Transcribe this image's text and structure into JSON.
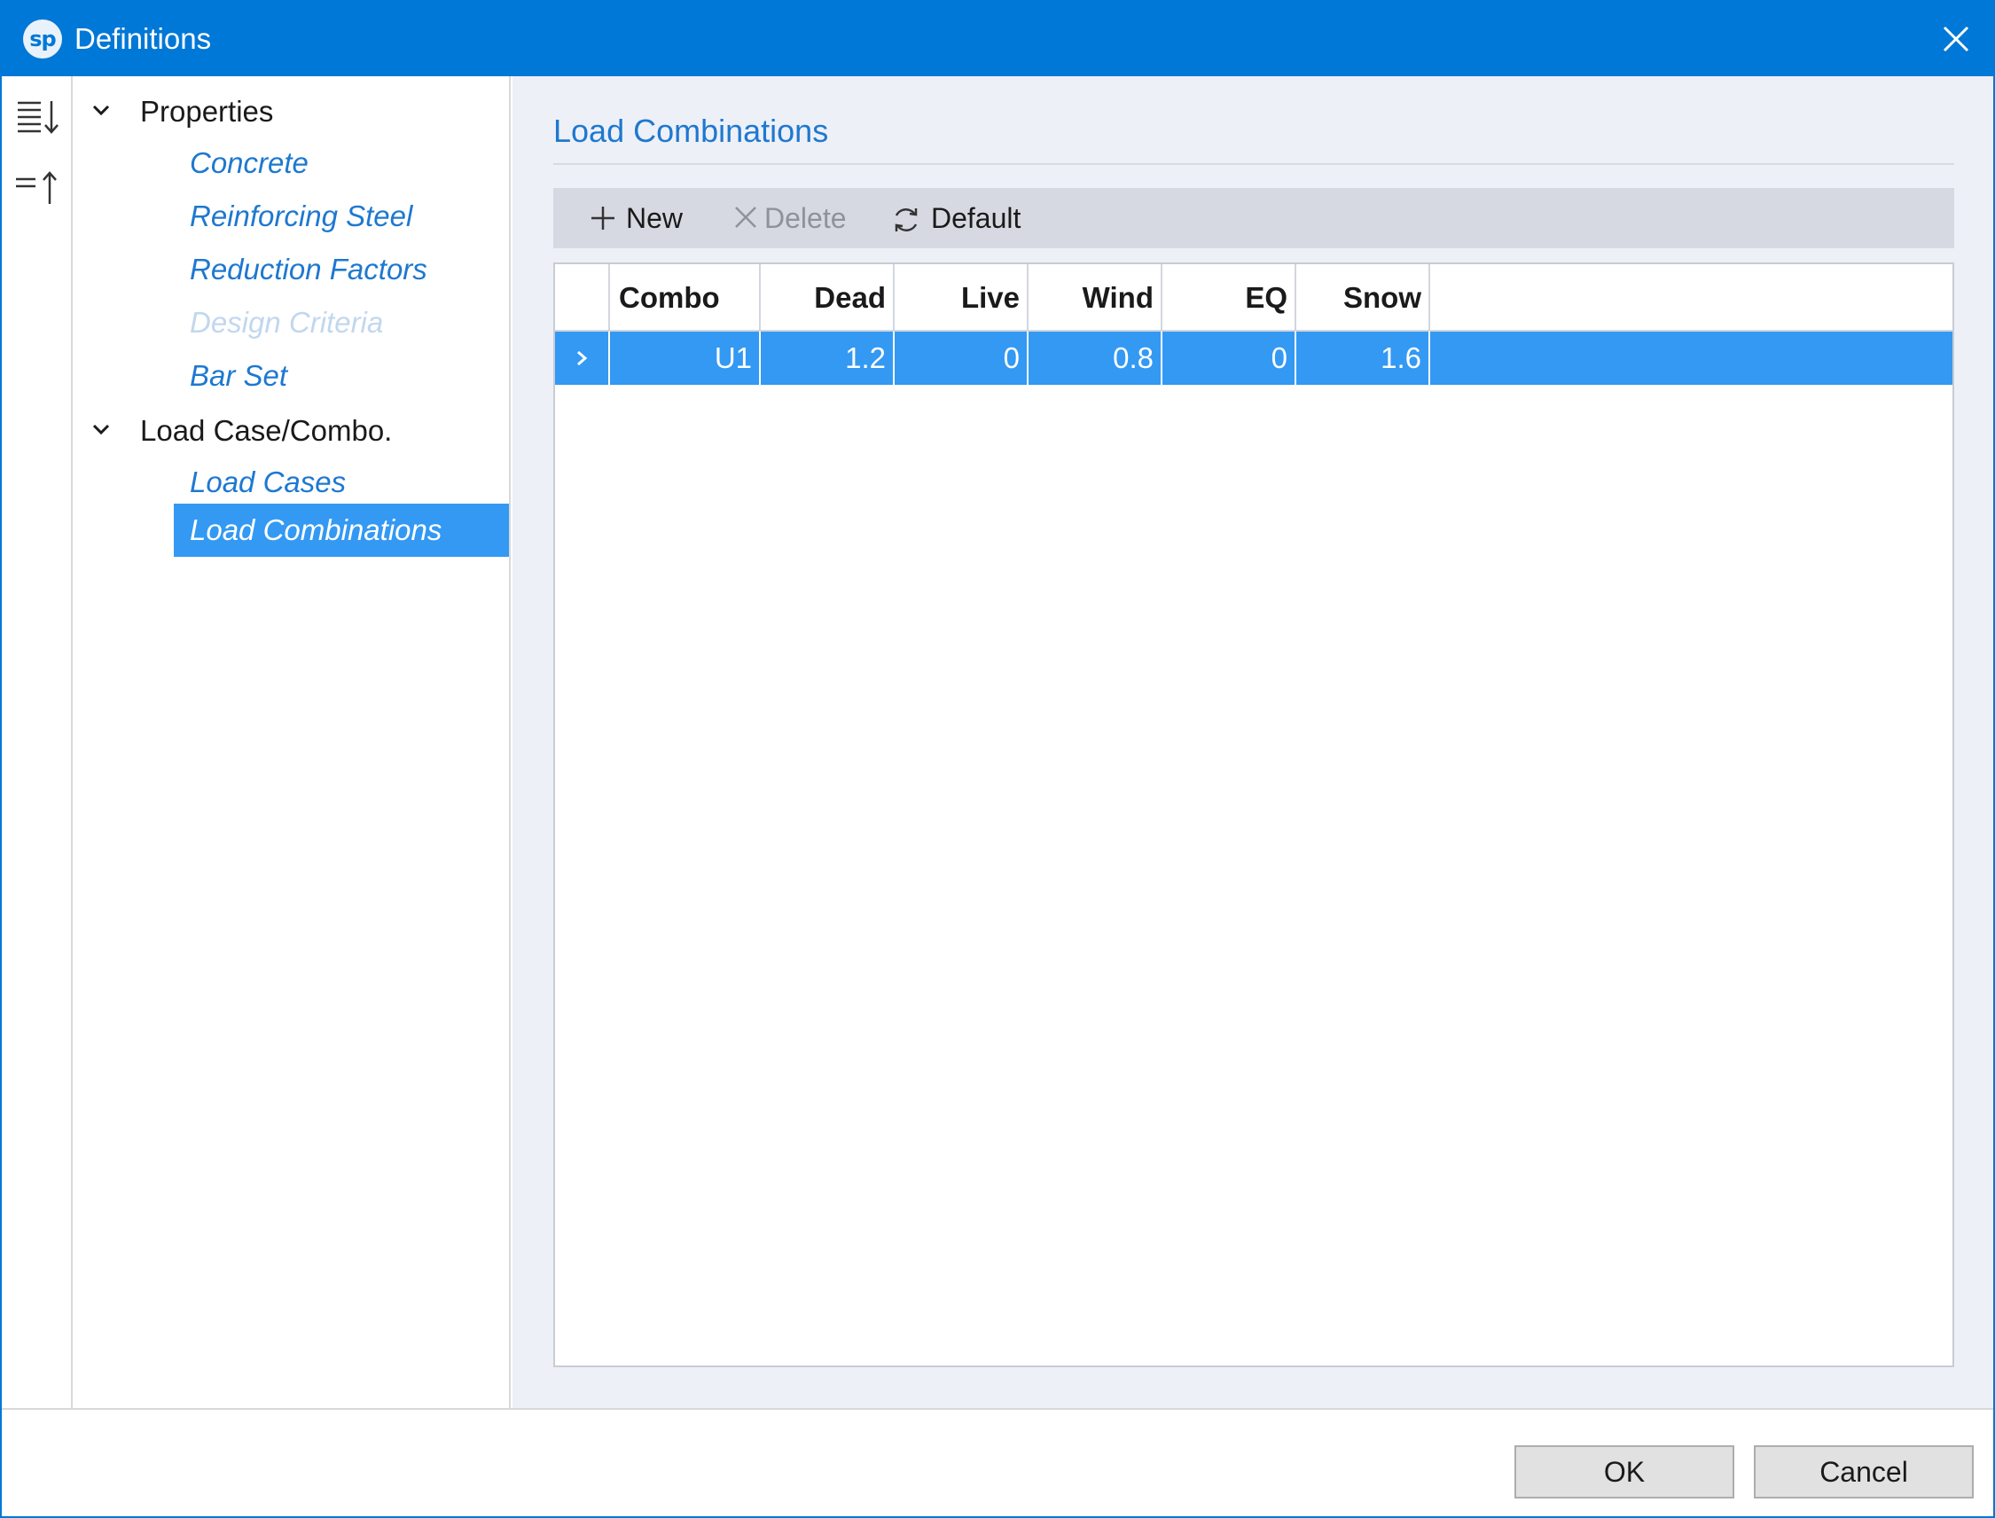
{
  "window": {
    "title": "Definitions",
    "logo_text": "sp"
  },
  "sidebar": {
    "groups": [
      {
        "label": "Properties",
        "items": [
          {
            "label": "Concrete",
            "state": "normal"
          },
          {
            "label": "Reinforcing Steel",
            "state": "normal"
          },
          {
            "label": "Reduction Factors",
            "state": "normal"
          },
          {
            "label": "Design Criteria",
            "state": "disabled"
          },
          {
            "label": "Bar Set",
            "state": "normal"
          }
        ]
      },
      {
        "label": "Load Case/Combo.",
        "items": [
          {
            "label": "Load Cases",
            "state": "normal"
          },
          {
            "label": "Load Combinations",
            "state": "selected"
          }
        ]
      }
    ]
  },
  "main": {
    "title": "Load Combinations",
    "toolbar": {
      "new_label": "New",
      "delete_label": "Delete",
      "default_label": "Default"
    },
    "table": {
      "columns": [
        "Combo",
        "Dead",
        "Live",
        "Wind",
        "EQ",
        "Snow"
      ],
      "rows": [
        [
          "U1",
          "1.2",
          "0",
          "0.8",
          "0",
          "1.6"
        ]
      ]
    }
  },
  "footer": {
    "ok_label": "OK",
    "cancel_label": "Cancel"
  },
  "colors": {
    "title_bar": "#0078d7",
    "accent": "#1e78d0",
    "selection": "#3399f3",
    "content_background": "#eef0f7",
    "toolbar_background": "#d6d9e2"
  }
}
